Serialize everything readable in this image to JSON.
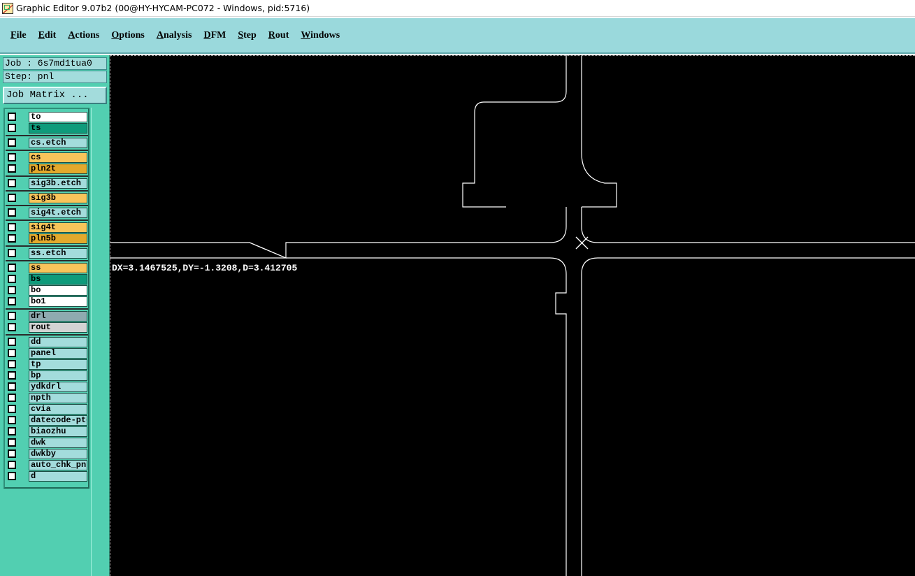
{
  "window": {
    "title": "Graphic Editor 9.07b2 (00@HY-HYCAM-PC072 - Windows, pid:5716)",
    "icon": "graphic-editor-app-icon"
  },
  "menu": [
    {
      "mnemonic": "F",
      "rest": "ile"
    },
    {
      "mnemonic": "E",
      "rest": "dit"
    },
    {
      "mnemonic": "A",
      "rest": "ctions"
    },
    {
      "mnemonic": "O",
      "rest": "ptions"
    },
    {
      "mnemonic": "A",
      "rest": "nalysis"
    },
    {
      "mnemonic": "D",
      "rest": "FM"
    },
    {
      "mnemonic": "S",
      "rest": "tep"
    },
    {
      "mnemonic": "R",
      "rest": "out"
    },
    {
      "mnemonic": "W",
      "rest": "indows"
    }
  ],
  "panel": {
    "job": "Job : 6s7md1tua0",
    "step": "Step: pnl",
    "job_matrix": "Job Matrix ..."
  },
  "layers": [
    {
      "name": "to",
      "color": "#ffffff",
      "group": 0
    },
    {
      "name": "ts",
      "color": "#0f9b7b",
      "group": 0
    },
    {
      "name": "cs.etch",
      "color": "#a3dcdc",
      "group": 1
    },
    {
      "name": "cs",
      "color": "#f8c45a",
      "group": 2
    },
    {
      "name": "pln2t",
      "color": "#e3a92c",
      "group": 2
    },
    {
      "name": "sig3b.etch",
      "color": "#a3dcdc",
      "group": 3
    },
    {
      "name": "sig3b",
      "color": "#f8c45a",
      "group": 4
    },
    {
      "name": "sig4t.etch",
      "color": "#a3dcdc",
      "group": 5
    },
    {
      "name": "sig4t",
      "color": "#f8c45a",
      "group": 6
    },
    {
      "name": "pln5b",
      "color": "#e3a92c",
      "group": 6
    },
    {
      "name": "ss.etch",
      "color": "#a3dcdc",
      "group": 7
    },
    {
      "name": "ss",
      "color": "#f8c45a",
      "group": 8
    },
    {
      "name": "bs",
      "color": "#0f9b7b",
      "group": 8
    },
    {
      "name": "bo",
      "color": "#ffffff",
      "group": 8
    },
    {
      "name": "bo1",
      "color": "#ffffff",
      "group": 8
    },
    {
      "name": "drl",
      "color": "#8faab0",
      "group": 9
    },
    {
      "name": "rout",
      "color": "#d3d3d3",
      "group": 9
    },
    {
      "name": "dd",
      "color": "#a3dcdc",
      "group": 10
    },
    {
      "name": "panel",
      "color": "#a3dcdc",
      "group": 10
    },
    {
      "name": "tp",
      "color": "#a3dcdc",
      "group": 10
    },
    {
      "name": "bp",
      "color": "#a3dcdc",
      "group": 10
    },
    {
      "name": "ydkdrl",
      "color": "#a3dcdc",
      "group": 10
    },
    {
      "name": "npth",
      "color": "#a3dcdc",
      "group": 10
    },
    {
      "name": "cvia",
      "color": "#a3dcdc",
      "group": 10
    },
    {
      "name": "datecode-ptd",
      "color": "#a3dcdc",
      "group": 10
    },
    {
      "name": "biaozhu",
      "color": "#a3dcdc",
      "group": 10
    },
    {
      "name": "dwk",
      "color": "#a3dcdc",
      "group": 10
    },
    {
      "name": "dwkby",
      "color": "#a3dcdc",
      "group": 10
    },
    {
      "name": "auto_chk_pnl",
      "color": "#a3dcdc",
      "group": 10
    },
    {
      "name": "d",
      "color": "#a3dcdc",
      "group": 10
    }
  ],
  "canvas": {
    "measurement": "DX=3.1467525,DY=-1.3208,D=3.412705",
    "background": "#000000",
    "stroke": "#ffffff"
  }
}
